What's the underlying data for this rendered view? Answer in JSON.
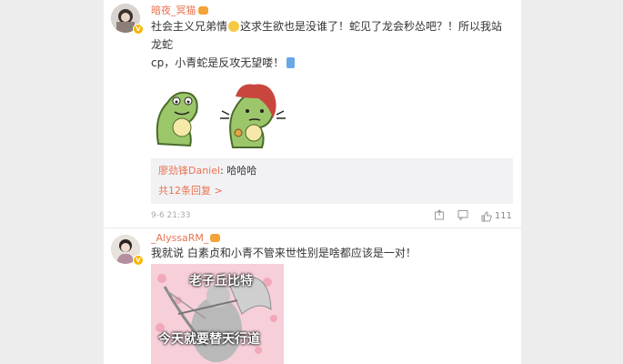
{
  "comments": [
    {
      "username": "暗夜_冥猫",
      "text_line1_a": "社会主义兄弟情",
      "text_line1_b": "这求生欲也是没谁了！蛇见了龙会秒怂吧？！所以我站龙蛇",
      "text_line2": "cp，小青蛇是反攻无望喽！",
      "reply": {
        "user": "廖劲锋Daniel",
        "sep": ": ",
        "text": "哈哈哈",
        "more": "共12条回复 >"
      },
      "time": "9-6 21:33",
      "likes": "111"
    },
    {
      "username": "_AlyssaRM_",
      "text": "我就说 白素贞和小青不管来世性别是啥都应该是一对！",
      "image_caption_top": "老子丘比特",
      "image_caption_bottom": "今天就要替天行道"
    }
  ],
  "colors": {
    "accent": "#eb7350",
    "background": "#ededed",
    "panel": "#ffffff",
    "reply_bg": "#f2f2f5",
    "meta": "#aaaaaa"
  },
  "icons": [
    "vip-crown-icon",
    "verified-badge-icon",
    "share-icon",
    "comment-icon",
    "like-icon",
    "smile-emoji-icon",
    "thinking-emoji-icon"
  ]
}
